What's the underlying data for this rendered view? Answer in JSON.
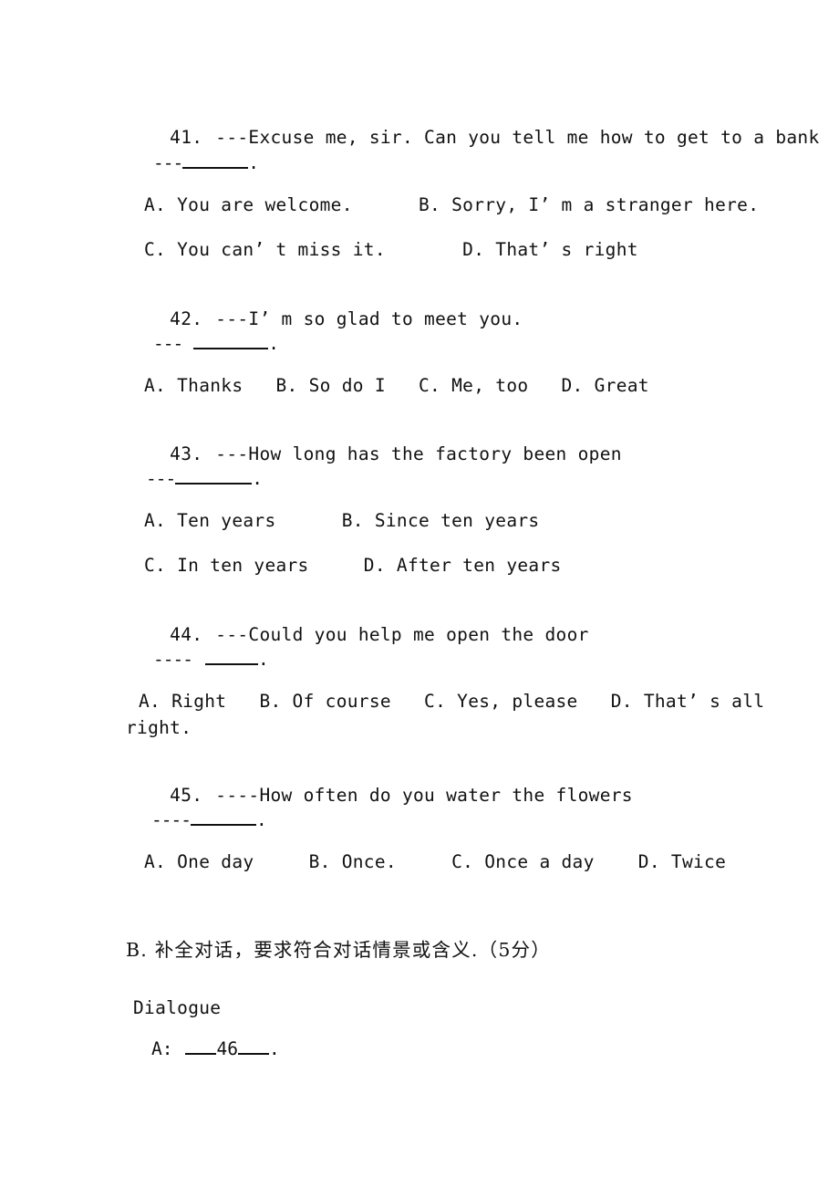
{
  "page": {
    "background": "#ffffff",
    "text_color": "#111111"
  },
  "questions": [
    {
      "number": "41.",
      "stem": "---Excuse me, sir. Can you tell me how to get to a bank",
      "answer_prompt": {
        "dashes": "---",
        "gap": false,
        "trailing": "."
      },
      "option_rows": [
        "A. You are welcome.      B. Sorry, I’ m a stranger here.",
        "C. You can’ t miss it.       D. That’ s right"
      ]
    },
    {
      "number": "42.",
      "stem": "---I’ m so glad to meet you.",
      "answer_prompt": {
        "dashes": "---",
        "gap": true,
        "trailing": "."
      },
      "option_rows": [
        "A. Thanks   B. So do I   C. Me, too   D. Great"
      ]
    },
    {
      "number": "43.",
      "stem": "---How long has the factory been open",
      "answer_prompt": {
        "dashes": "---",
        "gap": false,
        "trailing": "."
      },
      "option_rows": [
        "A. Ten years      B. Since ten years",
        "C. In ten years     D. After ten years"
      ]
    },
    {
      "number": "44.",
      "stem": "---Could you help me open the door",
      "answer_prompt": {
        "dashes": "----",
        "gap": true,
        "trailing": "."
      },
      "option_rows": [
        "A. Right   B. Of course   C. Yes, please   D. That’ s all",
        "right."
      ]
    },
    {
      "number": "45.",
      "stem": "----How often do you water the flowers",
      "answer_prompt": {
        "dashes": "----",
        "gap": false,
        "trailing": "."
      },
      "option_rows": [
        "A. One day     B. Once.     C. Once a day    D. Twice"
      ]
    }
  ],
  "section_b": {
    "heading": "B. 补全对话，要求符合对话情景或含义.（5分）",
    "dialogue_label": "Dialogue",
    "speaker": "A:",
    "blank_number": "46",
    "blank_trailing": "."
  }
}
